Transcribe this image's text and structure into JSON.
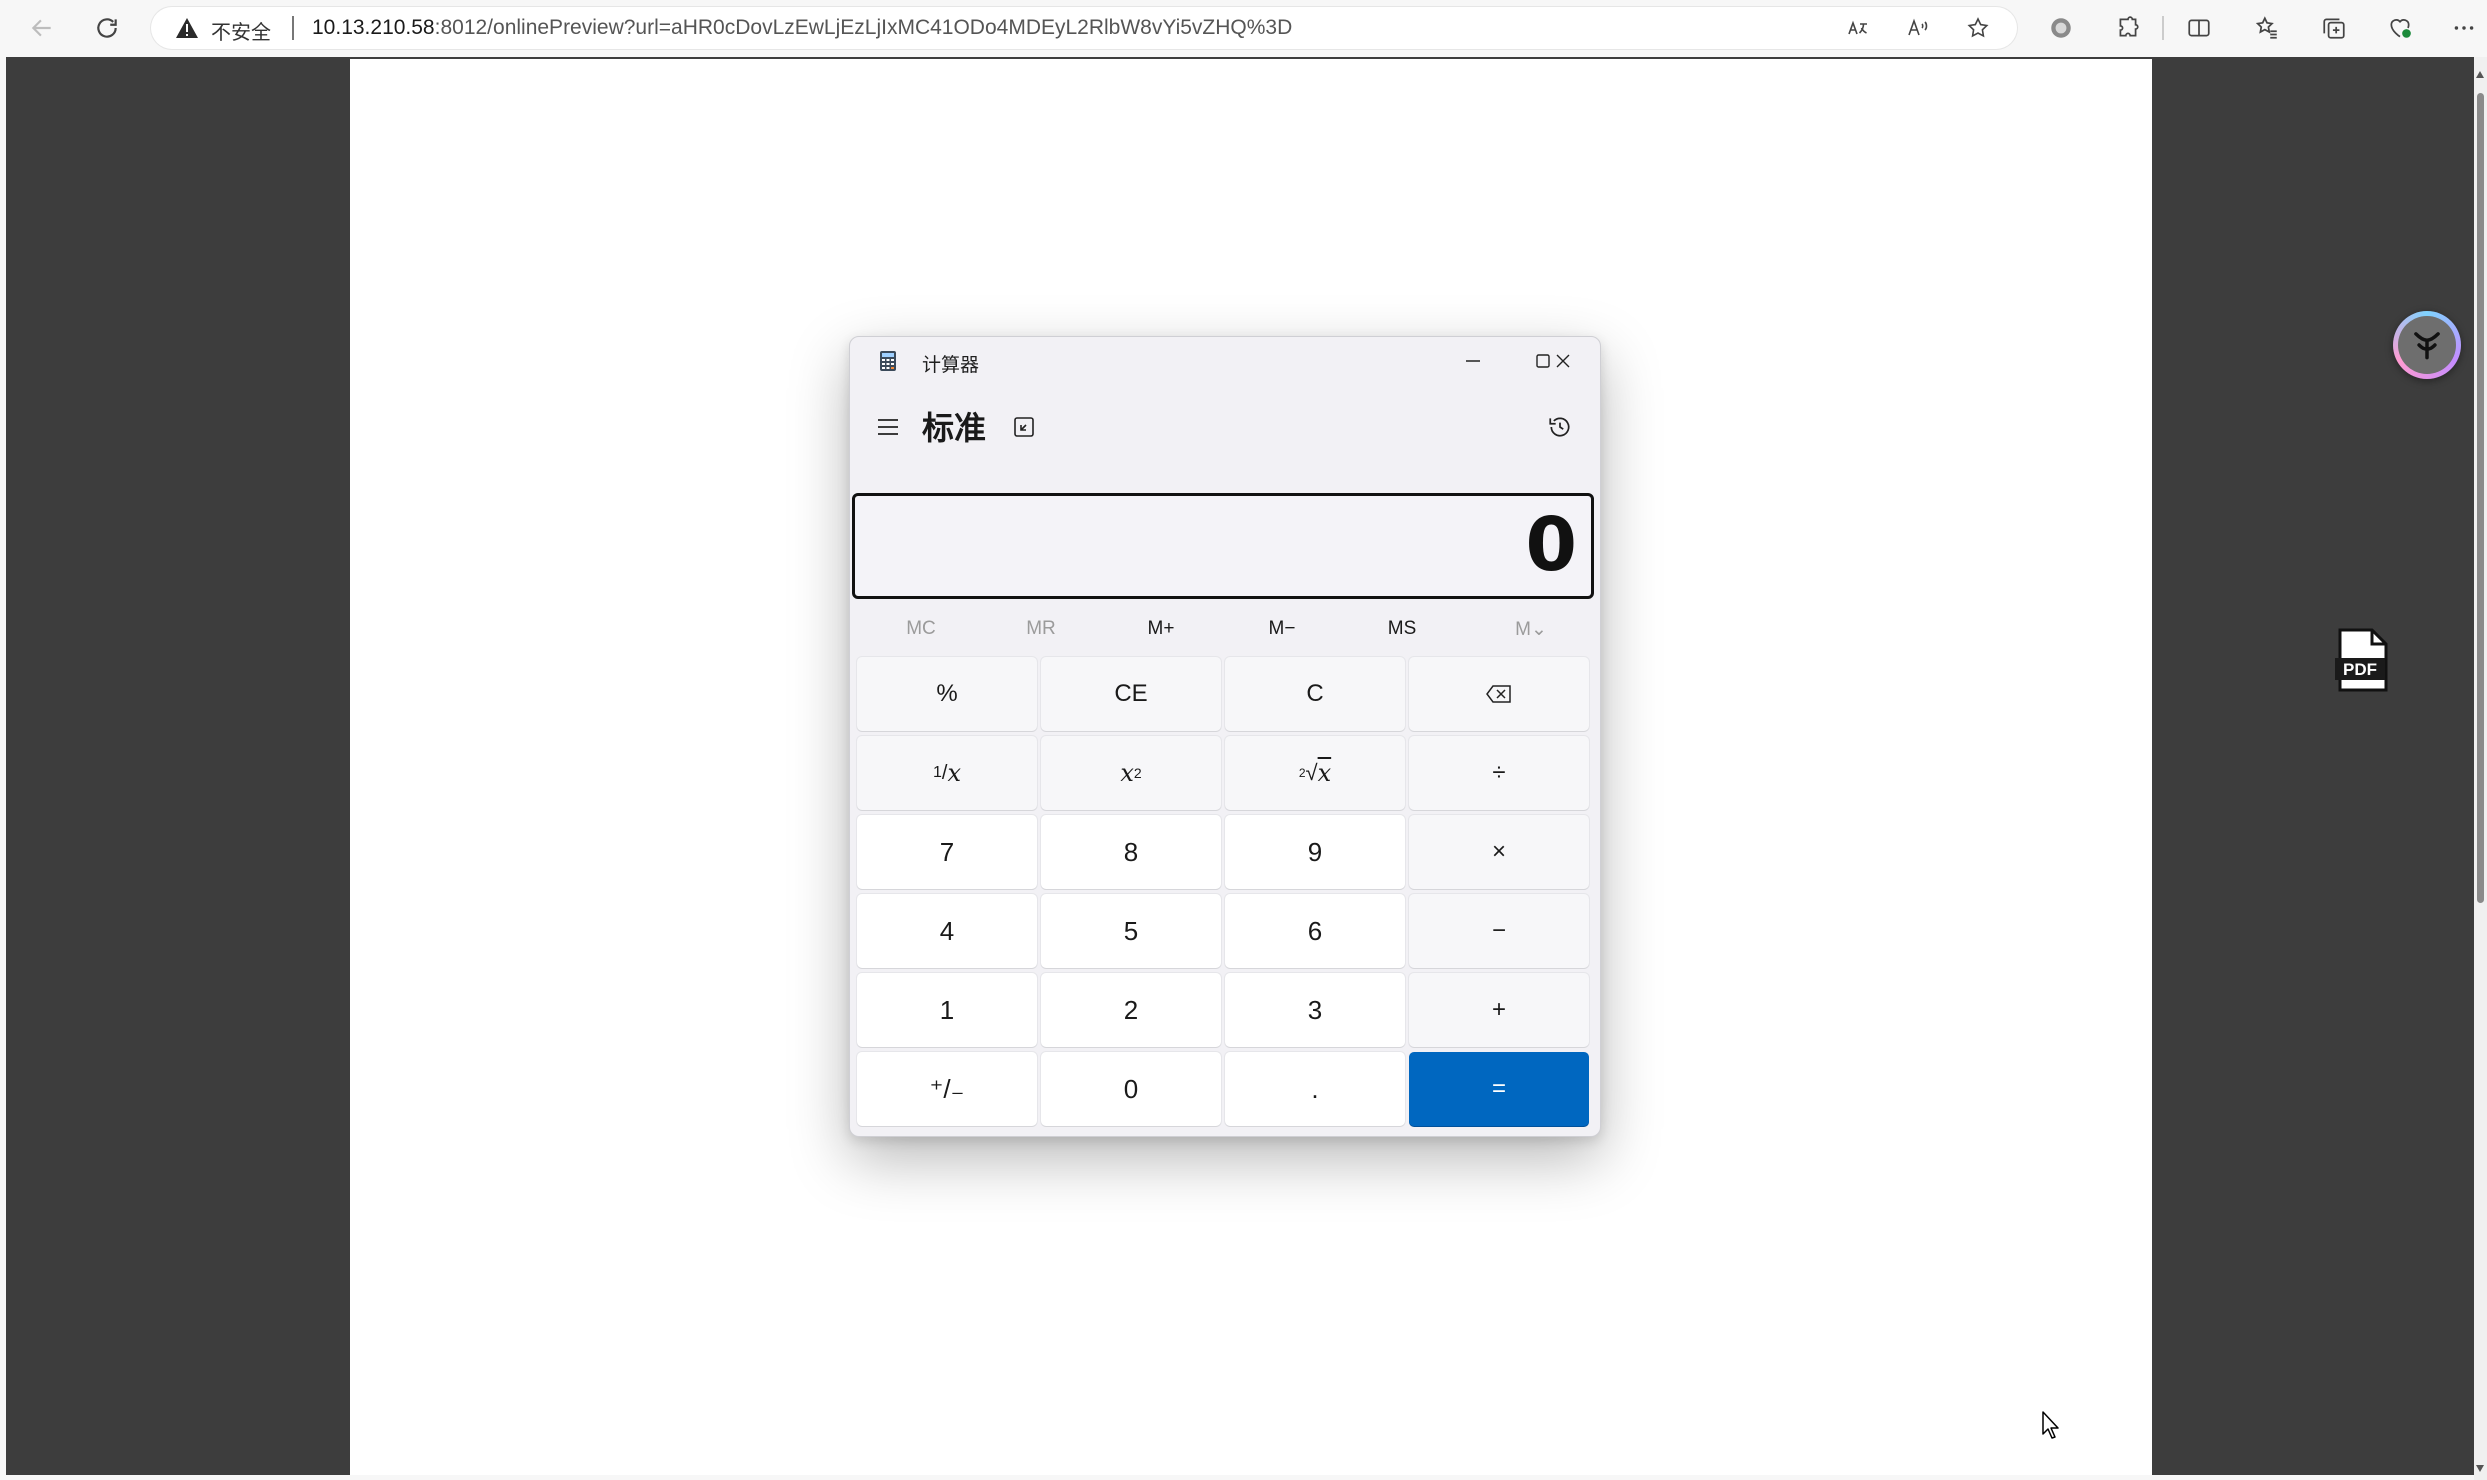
{
  "browser": {
    "security_label": "不安全",
    "url_host": "10.13.210.58",
    "url_rest": ":8012/onlinePreview?url=aHR0cDovLzEwLjEzLjIxMC41ODo4MDEyL2RlbW8vYi5vZHQ%3D"
  },
  "calculator": {
    "app_title": "计算器",
    "mode_title": "标准",
    "display_value": "0",
    "memory": [
      "MC",
      "MR",
      "M+",
      "M−",
      "MS",
      "M⌄"
    ],
    "keys": {
      "percent": "%",
      "clear_entry": "CE",
      "clear": "C",
      "reciprocal_num": "1",
      "reciprocal_den": "x",
      "square_base": "x",
      "square_exp": "2",
      "sqrt_index": "2",
      "sqrt_radicand": "x",
      "divide": "÷",
      "seven": "7",
      "eight": "8",
      "nine": "9",
      "multiply": "×",
      "four": "4",
      "five": "5",
      "six": "6",
      "minus": "−",
      "one": "1",
      "two": "2",
      "three": "3",
      "plus": "+",
      "negate": "⁺/₋",
      "zero": "0",
      "decimal": ".",
      "equals": "="
    }
  },
  "side": {
    "pdf_label": "PDF"
  },
  "colors": {
    "accent": "#0067c0",
    "viewer_bg": "#3d3d3d"
  }
}
